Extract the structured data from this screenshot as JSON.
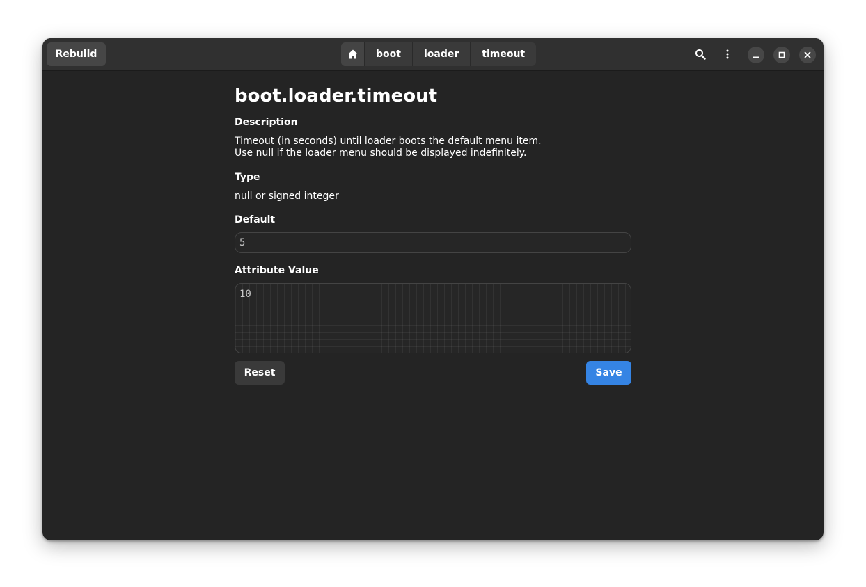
{
  "header": {
    "rebuild_label": "Rebuild",
    "breadcrumb": {
      "home_icon": "home-icon",
      "items": [
        "boot",
        "loader",
        "timeout"
      ]
    },
    "search_icon": "search-icon",
    "menu_icon": "vertical-dots-menu-icon",
    "window_controls": [
      "minimize-icon",
      "maximize-icon",
      "close-icon"
    ]
  },
  "main": {
    "title": "boot.loader.timeout",
    "description_label": "Description",
    "description_lines": [
      "Timeout (in seconds) until loader boots the default menu item.",
      "Use null if the loader menu should be displayed indefinitely."
    ],
    "type_label": "Type",
    "type_value": "null or signed integer",
    "default_label": "Default",
    "default_value": "5",
    "attribute_label": "Attribute Value",
    "attribute_value": "10",
    "reset_label": "Reset",
    "save_label": "Save"
  },
  "colors": {
    "window_bg": "#242424",
    "headerbar_bg": "#303030",
    "accent": "#3584e4"
  }
}
